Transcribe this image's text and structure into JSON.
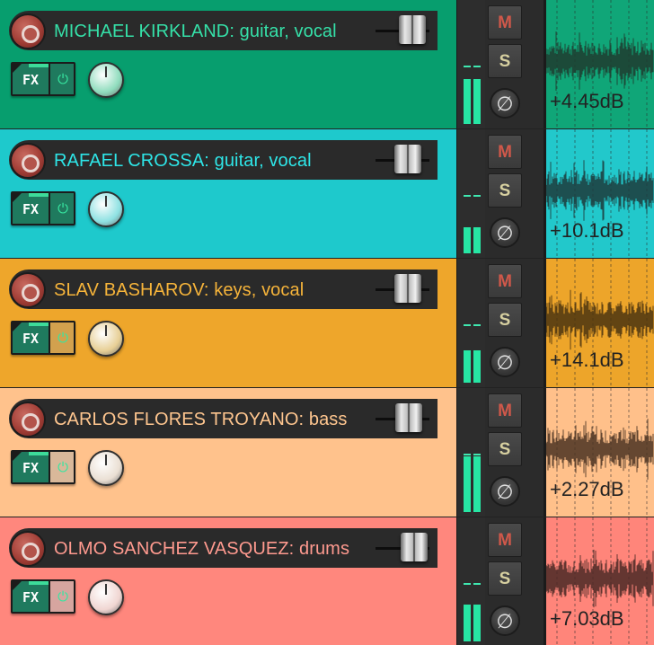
{
  "mixer": {
    "tracks": [
      {
        "name": "MICHAEL KIRKLAND: guitar, vocal",
        "gain": "+4.45dB",
        "fx_label": "FX",
        "mute_label": "M",
        "solo_label": "S",
        "phase_symbol": "∅",
        "power_symbol": "⏻",
        "colors": {
          "panel": "#079e6e",
          "name_text": "#35e0a8",
          "wave_bg": "#10a678",
          "wave_fg": "#1f3b2f",
          "knob": "#8fdcbd",
          "power_bg": "#1f7a5e"
        },
        "fader_level": 0.65,
        "meter_levels": [
          0.42,
          0.42
        ]
      },
      {
        "name": "RAFAEL CROSSA: guitar, vocal",
        "gain": "+10.1dB",
        "fx_label": "FX",
        "mute_label": "M",
        "solo_label": "S",
        "phase_symbol": "∅",
        "power_symbol": "⏻",
        "colors": {
          "panel": "#1ec9cc",
          "name_text": "#2ee6e8",
          "wave_bg": "#22c8cb",
          "wave_fg": "#1d3a3b",
          "knob": "#8ee1e2",
          "power_bg": "#1f7a5e"
        },
        "fader_level": 0.52,
        "meter_levels": [
          0.24,
          0.24
        ]
      },
      {
        "name": "SLAV BASHAROV: keys, vocal",
        "gain": "+14.1dB",
        "fx_label": "FX",
        "mute_label": "M",
        "solo_label": "S",
        "phase_symbol": "∅",
        "power_symbol": "⏻",
        "colors": {
          "panel": "#eea62b",
          "name_text": "#f6b43a",
          "wave_bg": "#eda52a",
          "wave_fg": "#4a3410",
          "knob": "#e7cf95",
          "power_bg": "#d2a14e"
        },
        "fader_level": 0.52,
        "meter_levels": [
          0.3,
          0.3
        ]
      },
      {
        "name": "CARLOS FLORES TROYANO: bass",
        "gain": "+2.27dB",
        "fx_label": "FX",
        "mute_label": "M",
        "solo_label": "S",
        "phase_symbol": "∅",
        "power_symbol": "⏻",
        "colors": {
          "panel": "#ffc28c",
          "name_text": "#ffc68f",
          "wave_bg": "#ffc08a",
          "wave_fg": "#4b3322",
          "knob": "#eadfd3",
          "power_bg": "#d9b89a"
        },
        "fader_level": 0.55,
        "meter_levels": [
          0.52,
          0.52
        ]
      },
      {
        "name": "OLMO SANCHEZ VASQUEZ: drums",
        "gain": "+7.03dB",
        "fx_label": "FX",
        "mute_label": "M",
        "solo_label": "S",
        "phase_symbol": "∅",
        "power_symbol": "⏻",
        "colors": {
          "panel": "#ff877d",
          "name_text": "#ff9a8f",
          "wave_bg": "#ff857a",
          "wave_fg": "#4a2925",
          "knob": "#f0d6d2",
          "power_bg": "#d6a59f"
        },
        "fader_level": 0.7,
        "meter_levels": [
          0.34,
          0.34
        ]
      }
    ]
  }
}
